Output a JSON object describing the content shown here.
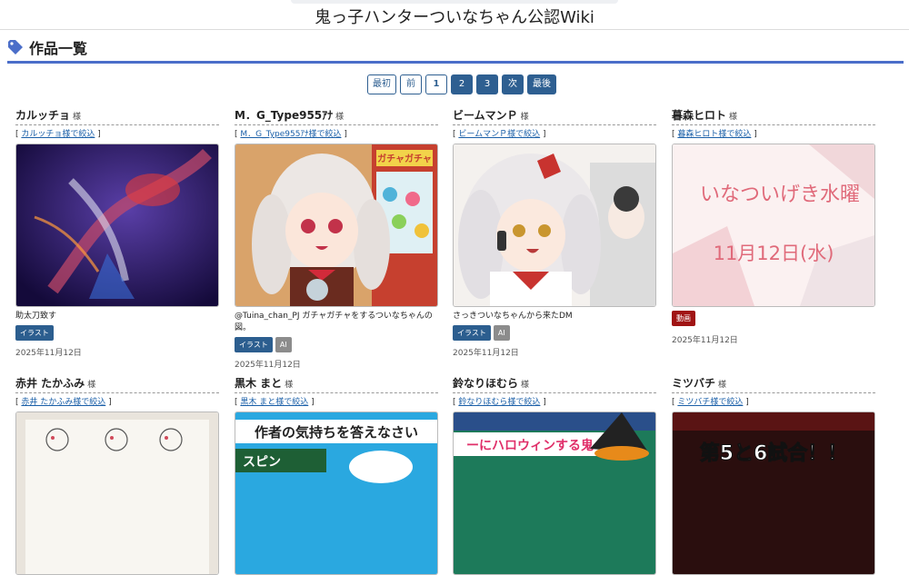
{
  "site": {
    "title": "鬼っ子ハンターついなちゃん公認Wiki"
  },
  "section": {
    "title": "作品一覧",
    "icon": "tag-icon"
  },
  "pager": {
    "first": "最初",
    "prev": "前",
    "pages": [
      "1",
      "2",
      "3"
    ],
    "next": "次",
    "last": "最後"
  },
  "common": {
    "sama": "様",
    "bracket_open": "[",
    "bracket_close": "]"
  },
  "cards": [
    {
      "author": "カルッチョ",
      "link": "カルッチョ様で絞込",
      "caption": "助太刀致す",
      "badges": [
        "イラスト"
      ],
      "date": "2025年11月12日",
      "image": "dark-purple-illustration"
    },
    {
      "author": "M．G_Type955ｱﾅ",
      "link": "M．G_Type955ｱﾅ様で絞込",
      "caption": "@Tuina_chan_PJ ガチャガチャをするついなちゃんの図。",
      "badges": [
        "イラスト",
        "AI"
      ],
      "date": "2025年11月12日",
      "image": "gacha-girl-illustration",
      "thumb_text": "ガチャガチャ"
    },
    {
      "author": "ビームマンＰ",
      "link": "ビームマンＰ様で絞込",
      "caption": "さっきついなちゃんから来たDM",
      "badges": [
        "イラスト",
        "AI"
      ],
      "date": "2025年11月12日",
      "image": "phone-girl-illustration"
    },
    {
      "author": "暮森ヒロト",
      "link": "暮森ヒロト様で絞込",
      "caption": "",
      "badges": [
        "動画"
      ],
      "date": "2025年11月12日",
      "image": "video-thumbnail",
      "thumb_text": "いなついげき水曜",
      "thumb_date": "11月12日(水)"
    },
    {
      "author": "赤井 たかふみ",
      "link": "赤井 たかふみ様で絞込",
      "image": "sketchbook-drawing"
    },
    {
      "author": "黒木 まと",
      "link": "黒木 まと様で絞込",
      "image": "quiz-thumbnail",
      "thumb_text": "作者の気持ちを答えなさい",
      "thumb_sub": "スピン"
    },
    {
      "author": "鈴なりほむら",
      "link": "鈴なりほむら様で絞込",
      "image": "halloween-thumbnail",
      "thumb_text": "ーにハロウィンする鬼"
    },
    {
      "author": "ミツバチ",
      "link": "ミツバチ様で絞込",
      "image": "match-thumbnail",
      "thumb_text": "第5と6試合！！"
    }
  ],
  "colors": {
    "accent": "#4b6ec9",
    "pager": "#2e5f91",
    "link": "#1a5fa8",
    "video_badge": "#a01414",
    "ai_badge": "#8c8c8c"
  }
}
